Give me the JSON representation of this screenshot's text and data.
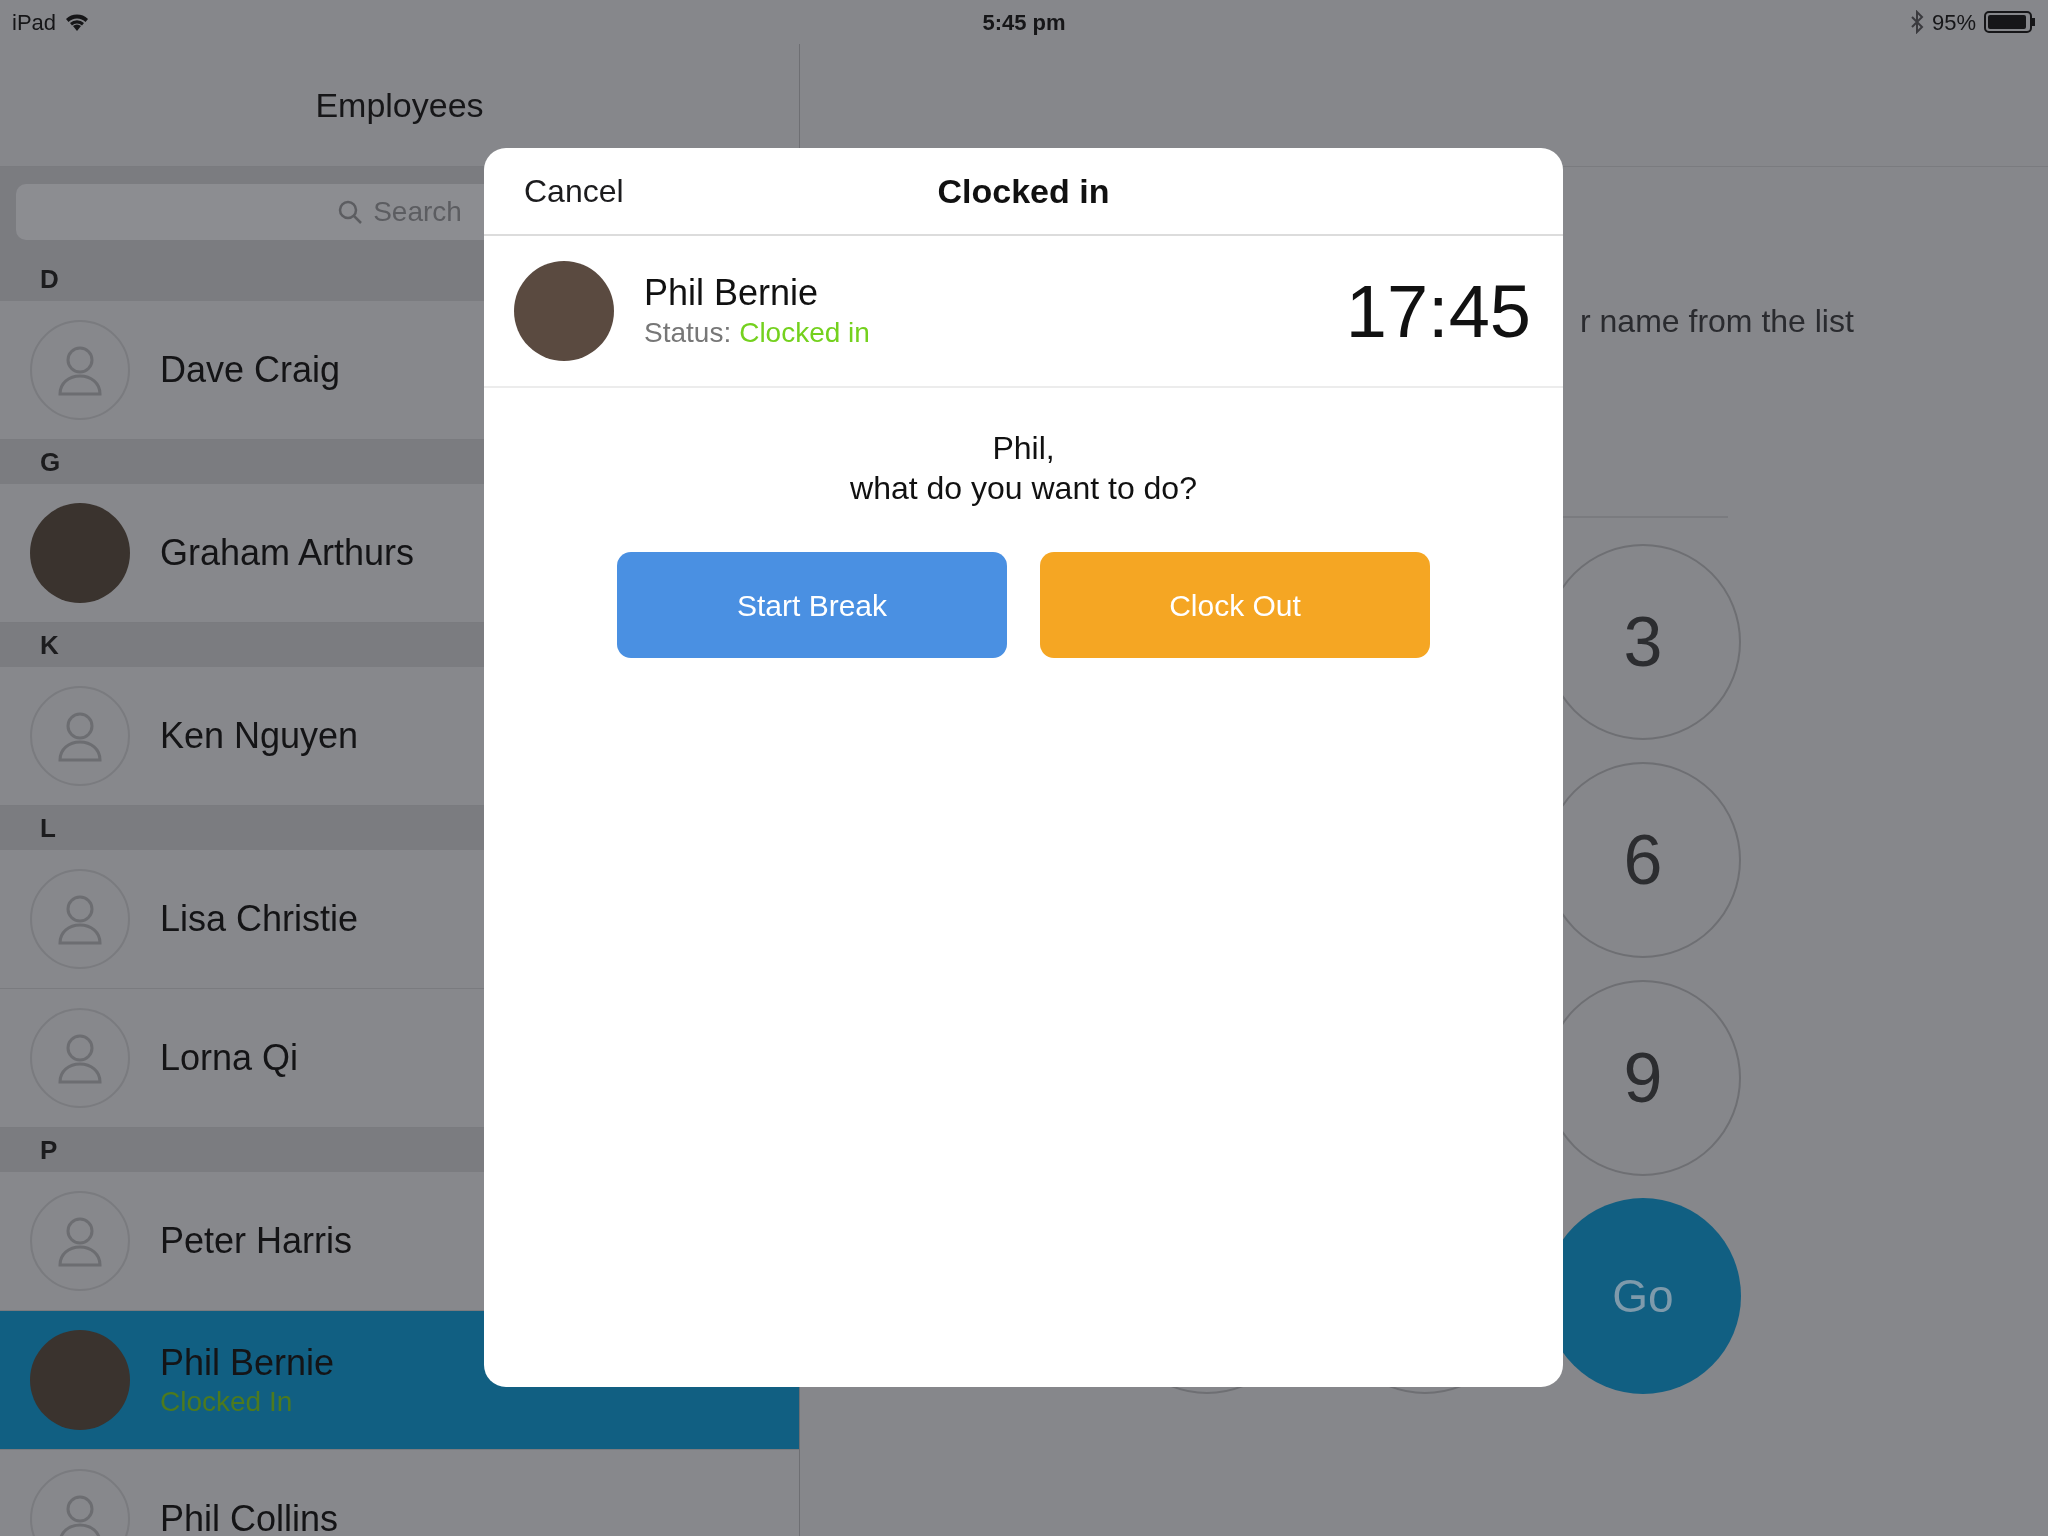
{
  "status_bar": {
    "device": "iPad",
    "time": "5:45 pm",
    "battery": "95%"
  },
  "sidebar": {
    "title": "Employees",
    "search": {
      "placeholder": "Search"
    },
    "sections": [
      {
        "letter": "D",
        "employees": [
          {
            "name": "Dave Craig",
            "kind": "placeholder",
            "selected": false
          }
        ]
      },
      {
        "letter": "G",
        "employees": [
          {
            "name": "Graham Arthurs",
            "kind": "photo",
            "selected": false
          }
        ]
      },
      {
        "letter": "K",
        "employees": [
          {
            "name": "Ken Nguyen",
            "kind": "placeholder",
            "selected": false
          }
        ]
      },
      {
        "letter": "L",
        "employees": [
          {
            "name": "Lisa Christie",
            "kind": "placeholder",
            "selected": false
          },
          {
            "name": "Lorna Qi",
            "kind": "placeholder",
            "selected": false
          }
        ]
      },
      {
        "letter": "P",
        "employees": [
          {
            "name": "Peter Harris",
            "kind": "placeholder",
            "selected": false
          },
          {
            "name": "Phil Bernie",
            "kind": "photo",
            "selected": true,
            "status": "Clocked In",
            "color": "#4d7a1e"
          },
          {
            "name": "Phil Collins",
            "kind": "placeholder",
            "selected": false
          }
        ]
      }
    ]
  },
  "main": {
    "prompt": "r name from the list",
    "keypad": [
      {
        "label": "3",
        "kind": "digit"
      },
      {
        "label": "6",
        "kind": "digit"
      },
      {
        "label": "9",
        "kind": "digit"
      },
      {
        "label": "Go",
        "kind": "go"
      }
    ]
  },
  "dialog": {
    "cancel": "Cancel",
    "title": "Clocked in",
    "employee": {
      "name": "Phil Bernie",
      "status_label": "Status:",
      "status": "Clocked in",
      "time": "17:45"
    },
    "question": [
      "Phil,",
      "what do you want to do?"
    ],
    "actions": [
      {
        "label": "Start Break",
        "kind": "break"
      },
      {
        "label": "Clock Out",
        "kind": "clockout"
      }
    ]
  }
}
